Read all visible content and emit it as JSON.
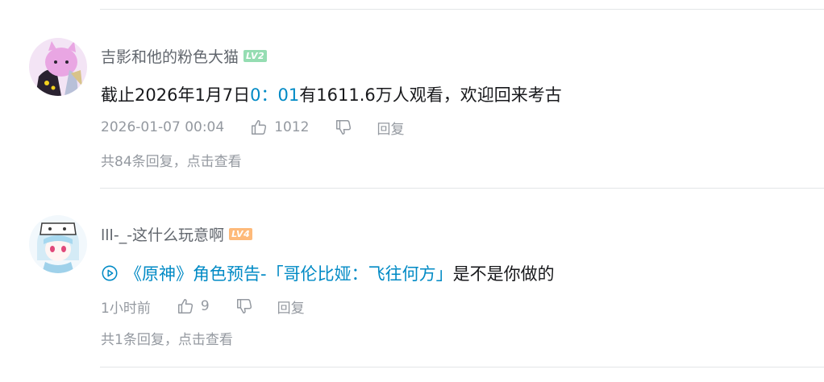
{
  "comments": [
    {
      "username": "吉影和他的粉色大猫",
      "level": "LV2",
      "level_color": "#95ddb2",
      "content_prefix": "截止2026年1月7日",
      "content_link": "0：01",
      "content_suffix": "有1611.6万人观看，欢迎回来考古",
      "time": "2026-01-07 00:04",
      "likes": "1012",
      "reply_label": "回复",
      "replies_text": "共84条回复，点击查看"
    },
    {
      "username": "lll-_-这什么玩意啊",
      "level": "LV4",
      "level_color": "#feba7a",
      "content_link": "《原神》角色预告-「哥伦比娅：飞往何方」",
      "content_suffix": "是不是你做的",
      "time": "1小时前",
      "likes": "9",
      "reply_label": "回复",
      "replies_text": "共1条回复，点击查看"
    }
  ],
  "icons": {
    "like": "thumbs-up-icon",
    "dislike": "thumbs-down-icon",
    "video_link": "play-circle-icon"
  },
  "colors": {
    "link": "#008ac5",
    "meta": "#9499a0",
    "username": "#61666d",
    "divider": "#e3e5e7"
  }
}
